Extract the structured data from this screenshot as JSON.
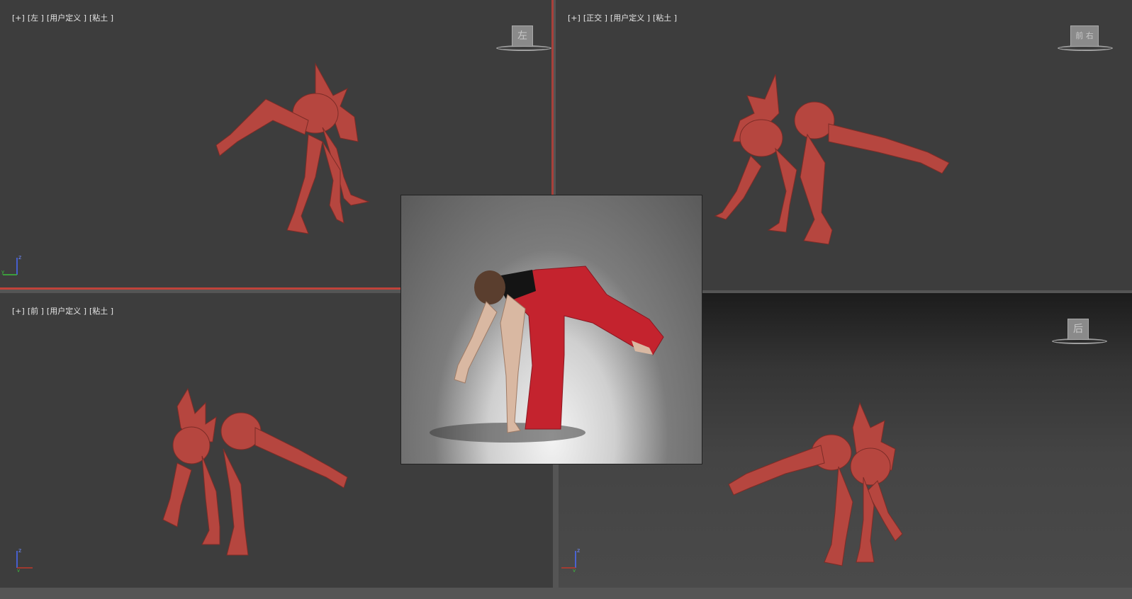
{
  "viewports": {
    "top_left": {
      "labels": [
        "[+]",
        "[左 ]",
        "[用户定义 ]",
        "[粘土 ]"
      ],
      "viewcube_face": "左"
    },
    "top_right": {
      "labels": [
        "[+]",
        "[正交 ]",
        "[用户定义 ]",
        "[粘土 ]"
      ],
      "viewcube_face": "前 右"
    },
    "bottom_left": {
      "labels": [
        "[+]",
        "[前 ]",
        "[用户定义 ]",
        "[粘土 ]"
      ],
      "viewcube_face": ""
    },
    "bottom_right": {
      "labels": [],
      "viewcube_face": "后"
    }
  },
  "colors": {
    "viewport_bg": "#3d3d3d",
    "model_clay": "#b6463f",
    "active_border": "#c0433a",
    "pants_red": "#c4232e"
  },
  "icons": [
    "viewcube-icon",
    "axis-gizmo-icon"
  ],
  "reference_photo": "dancer-reference-photo"
}
